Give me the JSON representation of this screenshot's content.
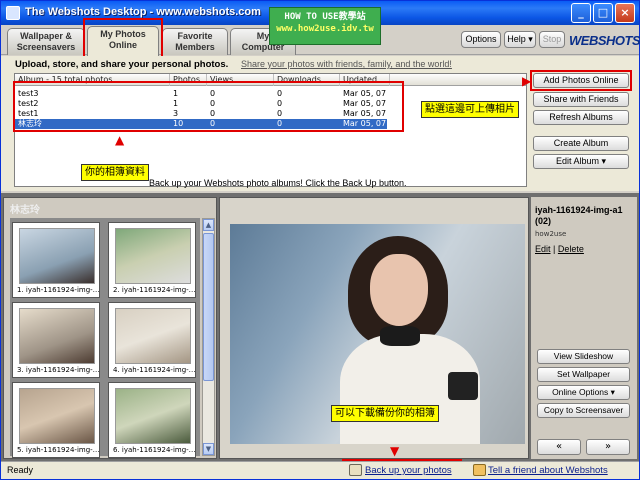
{
  "window": {
    "title": "The Webshots Desktop - www.webshots.com",
    "controls": [
      "_",
      "□",
      "×"
    ]
  },
  "tabs": [
    {
      "line1": "Wallpaper &",
      "line2": "Screensavers"
    },
    {
      "line1": "My Photos",
      "line2": "Online"
    },
    {
      "line1": "Favorite",
      "line2": "Members"
    },
    {
      "line1": "My",
      "line2": "Computer"
    }
  ],
  "header_buttons": {
    "options": "Options",
    "help": "Help ▾",
    "stop": "Stop"
  },
  "logo": "WEBSHOTS",
  "intro_text": "Upload, store, and share your personal photos.",
  "share_link": "Share your photos with friends, family, and the world!",
  "album_table": {
    "columns": [
      "Album - 15 total photos",
      "Photos",
      "Views",
      "Downloads",
      "Updated"
    ],
    "rows": [
      [
        "test3",
        "1",
        "0",
        "0",
        "Mar 05, 07"
      ],
      [
        "test2",
        "1",
        "0",
        "0",
        "Mar 05, 07"
      ],
      [
        "test1",
        "3",
        "0",
        "0",
        "Mar 05, 07"
      ],
      [
        "林志玲",
        "10",
        "0",
        "0",
        "Mar 05, 07"
      ]
    ]
  },
  "backup_hint": "Back up your Webshots photo albums! Click the Back Up button.",
  "right_buttons": {
    "add_photos": "Add Photos Online",
    "share_friends": "Share with Friends",
    "refresh": "Refresh Albums",
    "create_album": "Create Album",
    "edit_album": "Edit Album ▾"
  },
  "annotations": {
    "add_photos_note": "點選這邊可上傳相片",
    "album_data_note": "你的相簿資料",
    "backup_note": "可以下載備份你的相簿"
  },
  "watermark": {
    "line1": "HOW TO USE教學站",
    "line2": "www.how2use.idv.tw"
  },
  "album_pane": {
    "title": "林志玲",
    "thumbnails": [
      "1. iyah-1161924-img-…",
      "2. iyah-1161924-img-…",
      "3. iyah-1161924-img-…",
      "4. iyah-1161924-img-…",
      "5. iyah-1161924-img-…",
      "6. iyah-1161924-img-…"
    ]
  },
  "photo_info": {
    "name": "iyah-1161924-img-a1 (02)",
    "owner": "how2use",
    "edit": "Edit",
    "sep": "|",
    "delete": "Delete"
  },
  "photo_buttons": {
    "slideshow": "View Slideshow",
    "wallpaper": "Set Wallpaper",
    "online_options": "Online Options ▾",
    "copy_screensaver": "Copy to Screensaver",
    "prev": "«",
    "next": "»"
  },
  "status": {
    "text": "Ready",
    "backup_link": "Back up your photos",
    "tell_friend": "Tell a friend about Webshots"
  },
  "colors": {
    "accent_red": "#e00000",
    "callout_yellow": "#ffff00",
    "selection": "#316ac5",
    "titlebar": "#0a5cf5"
  },
  "icons": [
    "app-icon",
    "minimize-icon",
    "maximize-icon",
    "close-icon",
    "backup-icon",
    "tell-friend-icon",
    "scroll-up-icon",
    "scroll-down-icon"
  ]
}
